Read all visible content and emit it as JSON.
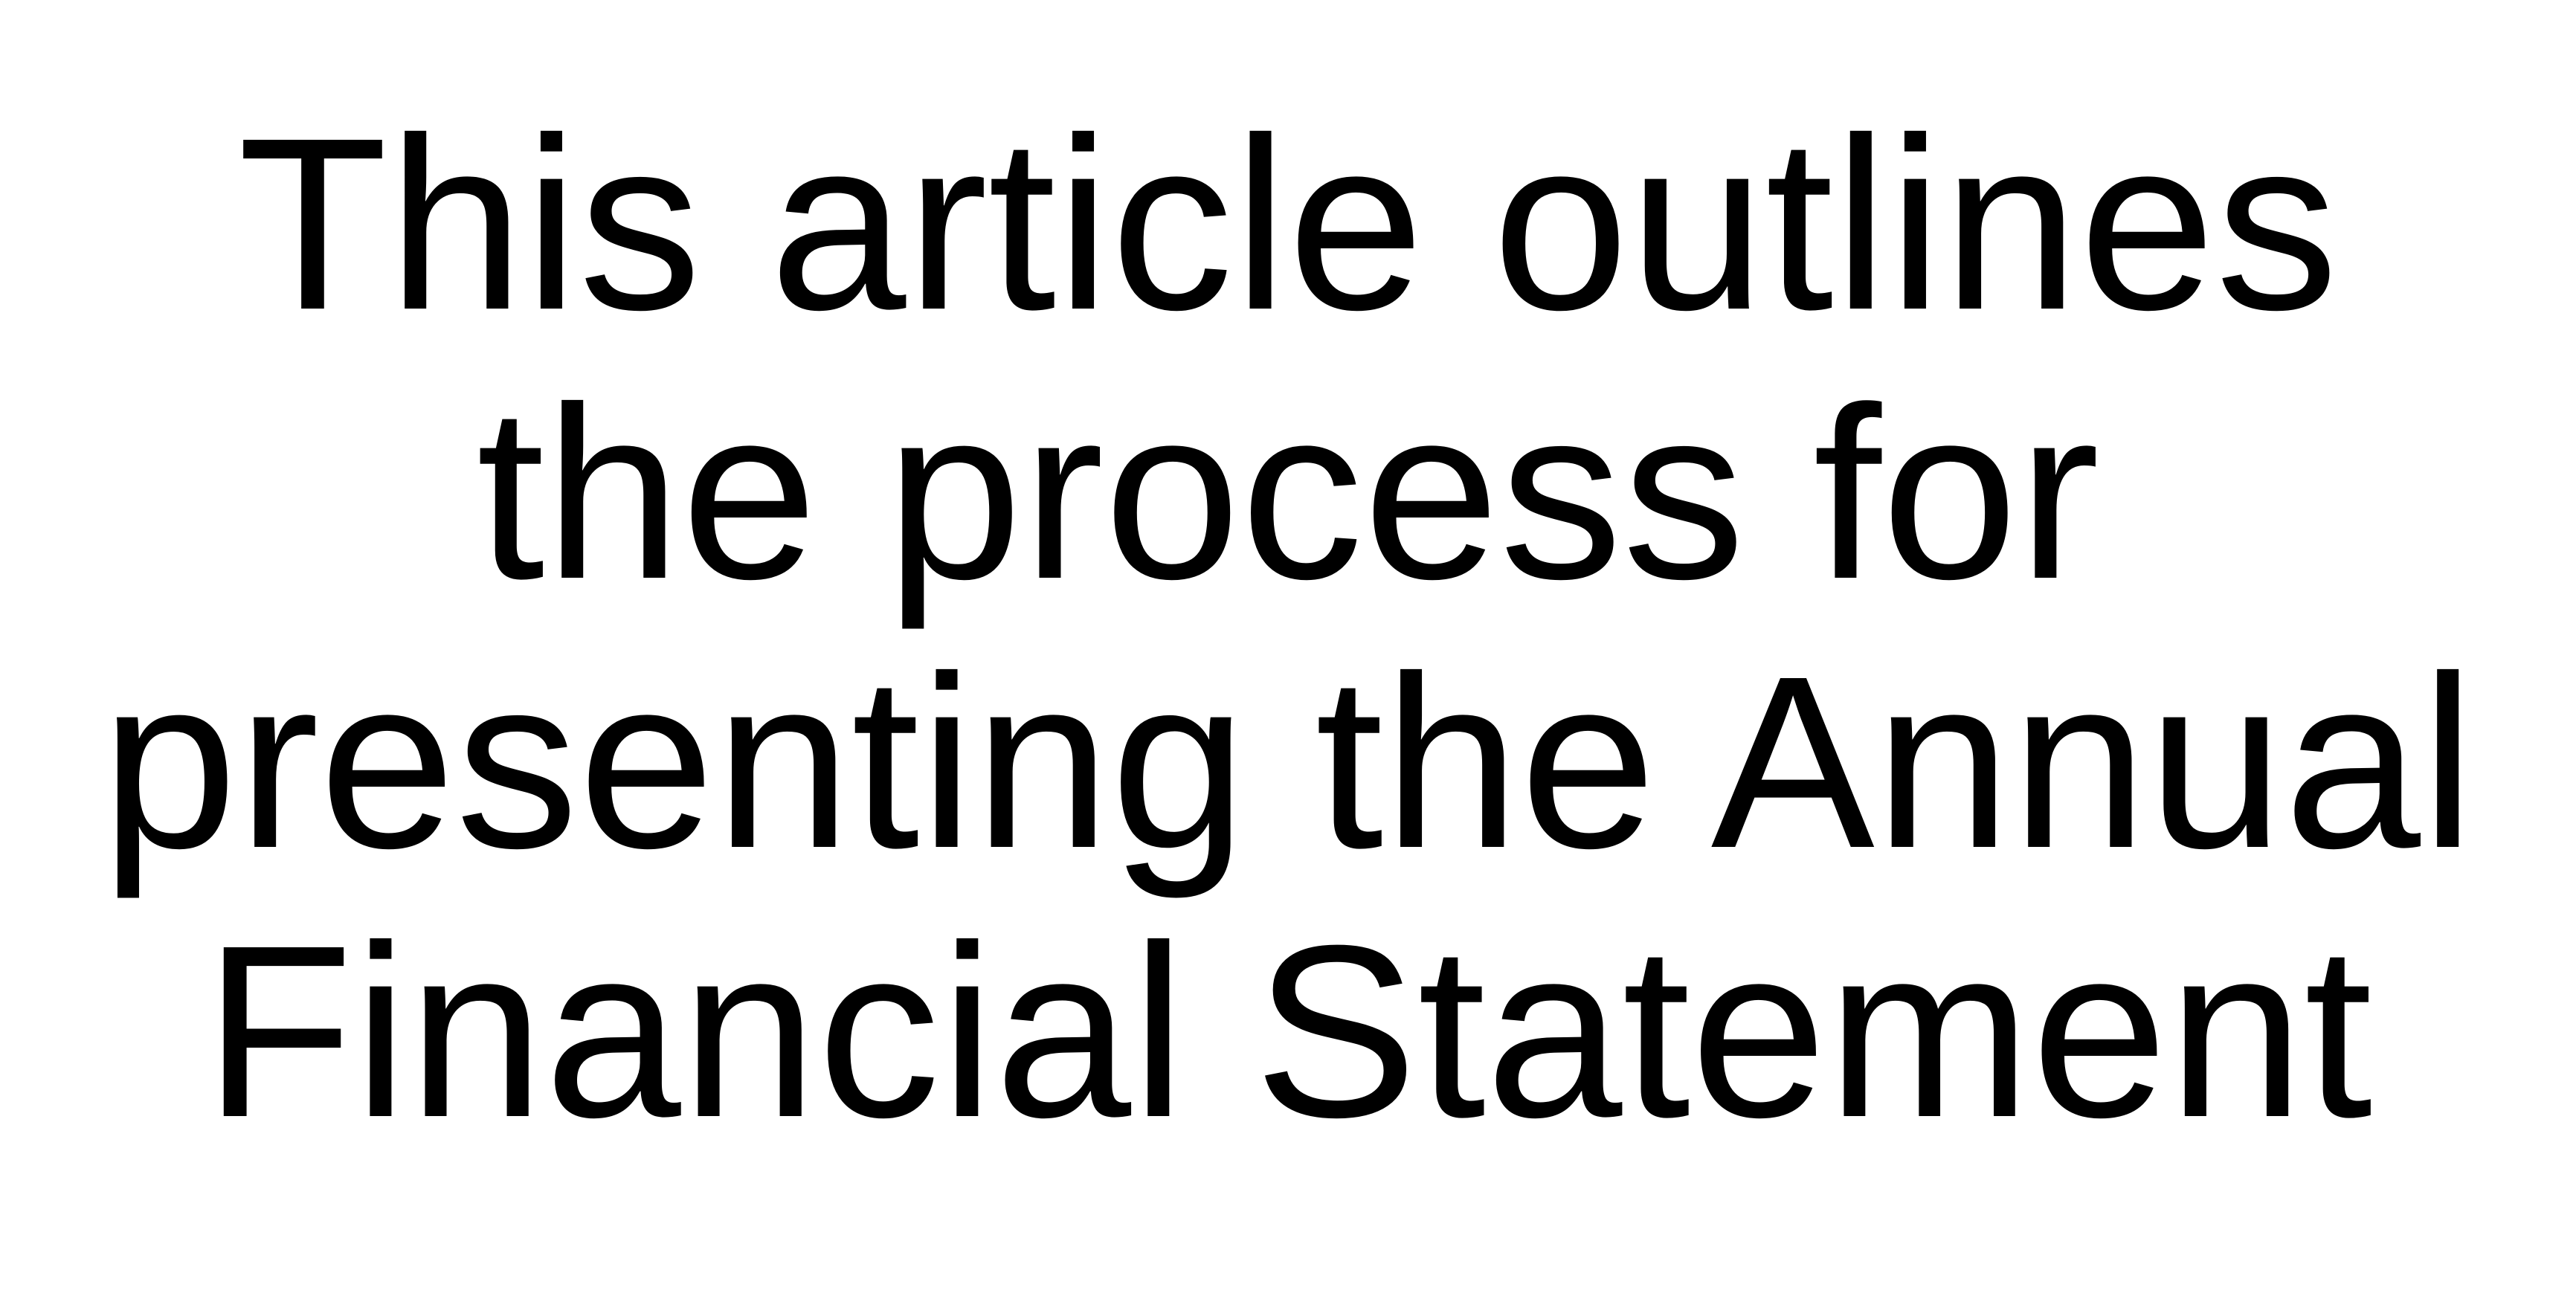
{
  "document": {
    "headline_lines": [
      "This article outlines",
      "the process for",
      "presenting the Annual",
      "Financial Statement"
    ]
  },
  "colors": {
    "background": "#ffffff",
    "text": "#000000"
  }
}
